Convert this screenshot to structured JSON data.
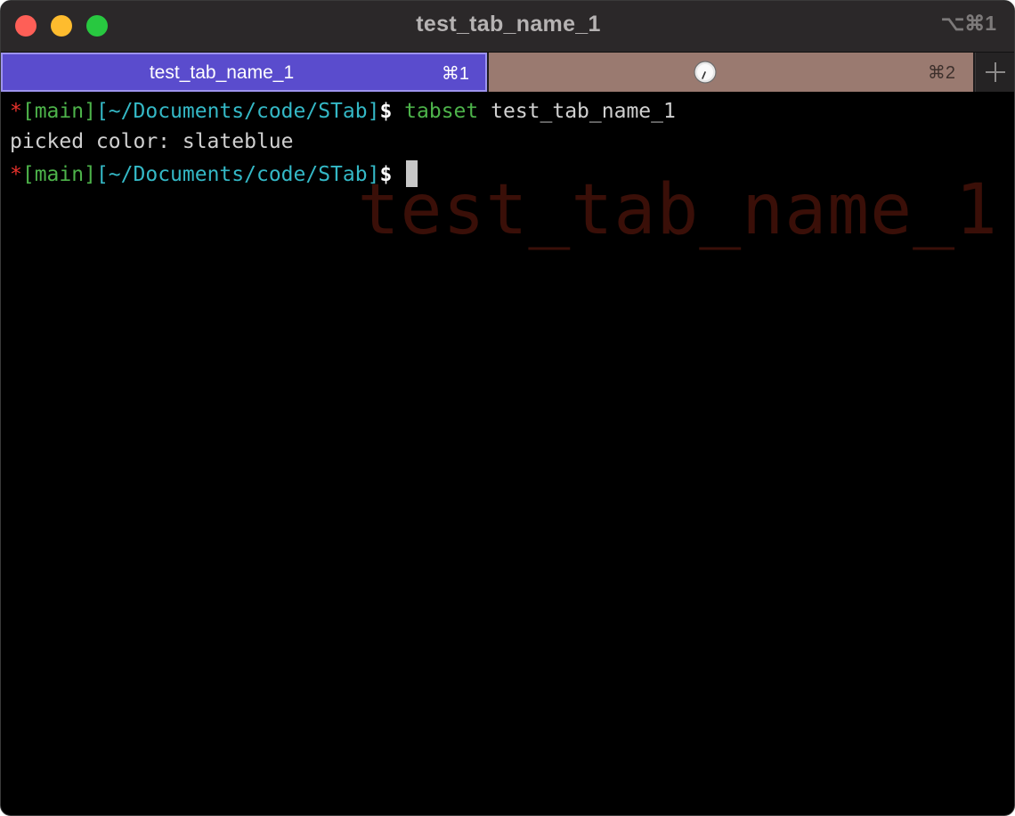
{
  "window": {
    "title": "test_tab_name_1",
    "shortcut": "⌥⌘1"
  },
  "tabs": [
    {
      "label": "test_tab_name_1",
      "shortcut": "⌘1",
      "active": true,
      "color": "#5a4ccd"
    },
    {
      "label": "",
      "shortcut": "⌘2",
      "active": false,
      "color": "#9a7a70",
      "icon": "clock-icon"
    }
  ],
  "new_tab_icon": "plus-icon",
  "terminal": {
    "watermark": "test_tab_name_1",
    "prompt": {
      "star": "*",
      "branch": "[main]",
      "path": "[~/Documents/code/STab]",
      "dollar": "$"
    },
    "command": "tabset",
    "command_arg": "test_tab_name_1",
    "output": "picked color: slateblue"
  }
}
